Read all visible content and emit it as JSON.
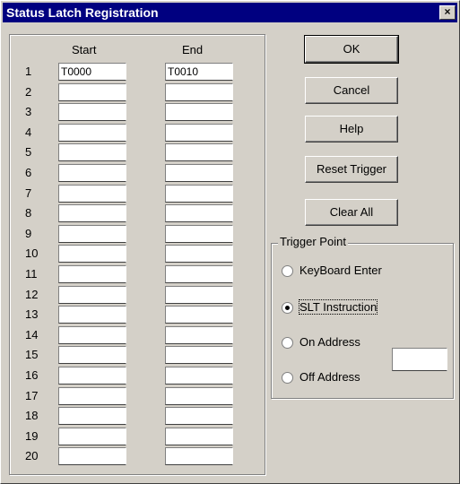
{
  "title": "Status Latch Registration",
  "close_glyph": "×",
  "columns": {
    "start": "Start",
    "end": "End"
  },
  "rows": [
    {
      "num": "1",
      "start": "T0000",
      "end": "T0010"
    },
    {
      "num": "2",
      "start": "",
      "end": ""
    },
    {
      "num": "3",
      "start": "",
      "end": ""
    },
    {
      "num": "4",
      "start": "",
      "end": ""
    },
    {
      "num": "5",
      "start": "",
      "end": ""
    },
    {
      "num": "6",
      "start": "",
      "end": ""
    },
    {
      "num": "7",
      "start": "",
      "end": ""
    },
    {
      "num": "8",
      "start": "",
      "end": ""
    },
    {
      "num": "9",
      "start": "",
      "end": ""
    },
    {
      "num": "10",
      "start": "",
      "end": ""
    },
    {
      "num": "11",
      "start": "",
      "end": ""
    },
    {
      "num": "12",
      "start": "",
      "end": ""
    },
    {
      "num": "13",
      "start": "",
      "end": ""
    },
    {
      "num": "14",
      "start": "",
      "end": ""
    },
    {
      "num": "15",
      "start": "",
      "end": ""
    },
    {
      "num": "16",
      "start": "",
      "end": ""
    },
    {
      "num": "17",
      "start": "",
      "end": ""
    },
    {
      "num": "18",
      "start": "",
      "end": ""
    },
    {
      "num": "19",
      "start": "",
      "end": ""
    },
    {
      "num": "20",
      "start": "",
      "end": ""
    }
  ],
  "buttons": {
    "ok": "OK",
    "cancel": "Cancel",
    "help": "Help",
    "reset_trigger": "Reset Trigger",
    "clear_all": "Clear All"
  },
  "trigger": {
    "legend": "Trigger Point",
    "options": [
      {
        "label": "KeyBoard Enter",
        "checked": false
      },
      {
        "label": "SLT Instruction",
        "checked": true
      },
      {
        "label": "On Address",
        "checked": false
      },
      {
        "label": "Off Address",
        "checked": false
      }
    ],
    "address_value": ""
  }
}
